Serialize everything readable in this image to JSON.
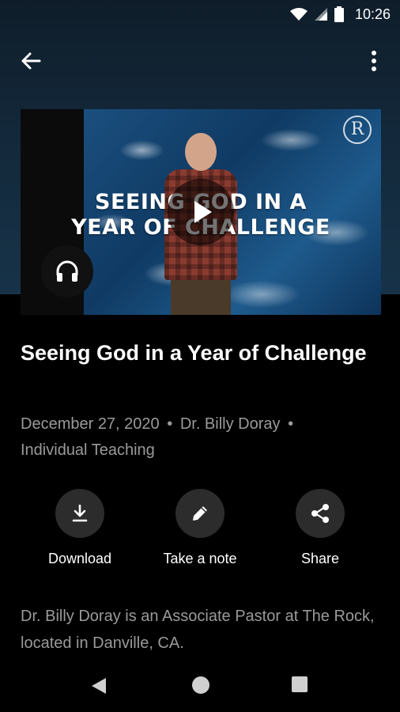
{
  "status_bar": {
    "time": "10:26"
  },
  "app_bar": {
    "back_icon": "arrow-back-icon",
    "menu_icon": "more-vert-icon"
  },
  "media": {
    "thumbnail_title_line1": "SEEING GOD IN A",
    "thumbnail_title_line2": "YEAR OF CHALLENGE",
    "logo_letter": "R",
    "play_icon": "play-icon",
    "audio_icon": "headphones-icon"
  },
  "message": {
    "title": "Seeing God in a Year of Challenge",
    "date": "December 27, 2020",
    "speaker": "Dr. Billy Doray",
    "separator": "•",
    "category": "Individual Teaching",
    "description": "Dr. Billy Doray is an Associate Pastor at The Rock, located in Danville, CA."
  },
  "actions": [
    {
      "label": "Download",
      "icon": "download-icon"
    },
    {
      "label": "Take a note",
      "icon": "pencil-icon"
    },
    {
      "label": "Share",
      "icon": "share-icon"
    }
  ],
  "colors": {
    "background": "#000000",
    "header_bg": "#173349",
    "muted_text": "#9a9a9a",
    "action_circle": "#2c2c2c"
  }
}
